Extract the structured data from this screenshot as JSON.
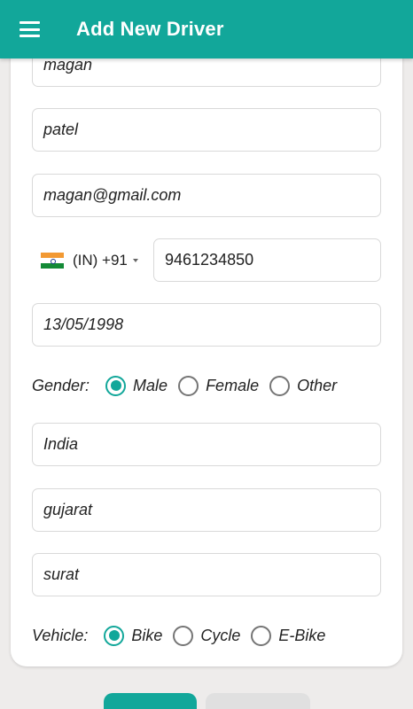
{
  "appbar": {
    "title": "Add New Driver",
    "color": "#12a79a"
  },
  "form": {
    "first_name": "magan",
    "last_name": "patel",
    "email": "magan@gmail.com",
    "phone": {
      "country_code": "(IN) +91",
      "number": "9461234850"
    },
    "dob": "13/05/1998",
    "gender": {
      "label": "Gender:",
      "options": [
        "Male",
        "Female",
        "Other"
      ],
      "selected": "Male"
    },
    "country": "India",
    "state": "gujarat",
    "city": "surat",
    "vehicle": {
      "label": "Vehicle:",
      "options": [
        "Bike",
        "Cycle",
        "E-Bike"
      ],
      "selected": "Bike"
    }
  }
}
